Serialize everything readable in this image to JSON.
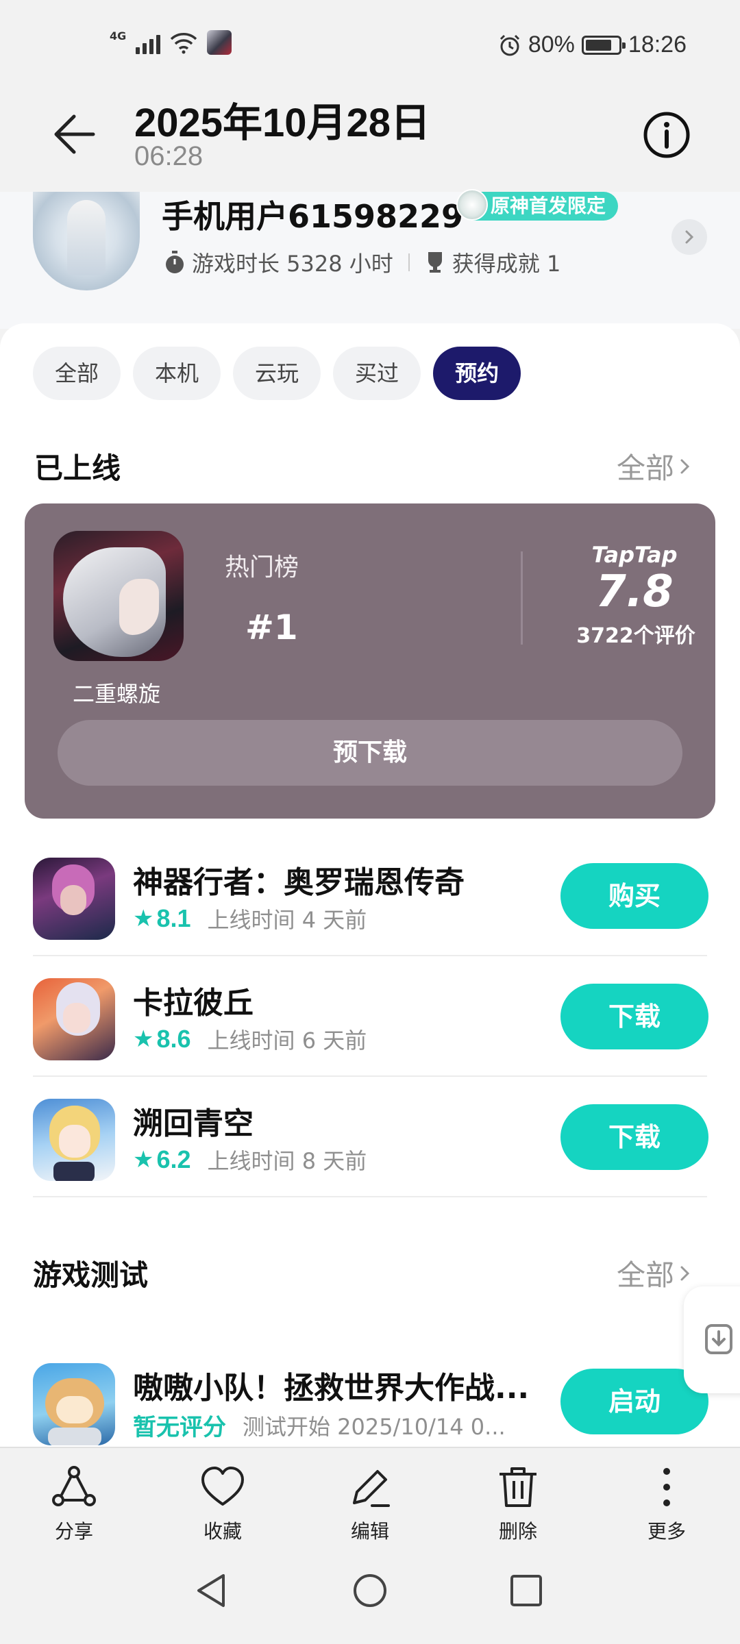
{
  "status": {
    "network": "4G",
    "battery": "80%",
    "time": "18:26"
  },
  "header": {
    "date": "2025年10月28日",
    "time": "06:28"
  },
  "profile": {
    "name": "手机用户61598229",
    "badge": "原神首发限定",
    "playtime": "游戏时长 5328 小时",
    "achievements": "获得成就 1"
  },
  "filters": [
    "全部",
    "本机",
    "云玩",
    "买过",
    "预约"
  ],
  "released_section": {
    "title": "已上线",
    "more": "全部"
  },
  "featured": {
    "name": "二重螺旋",
    "chart_label": "热门榜",
    "rank": "#1",
    "brand": "TapTap",
    "score": "7.8",
    "reviews": "3722个评价",
    "button": "预下载"
  },
  "games": [
    {
      "name": "神器行者：奥罗瑞恩传奇",
      "score": "8.1",
      "info": "上线时间 4 天前",
      "button": "购买"
    },
    {
      "name": "卡拉彼丘",
      "score": "8.6",
      "info": "上线时间 6 天前",
      "button": "下载"
    },
    {
      "name": "溯回青空",
      "score": "6.2",
      "info": "上线时间 8 天前",
      "button": "下载"
    }
  ],
  "test_section": {
    "title": "游戏测试",
    "more": "全部",
    "game": {
      "name": "嗷嗷小队！拯救世界大作战...",
      "score": "暂无评分",
      "info": "测试开始 2025/10/14 0...",
      "button": "启动"
    }
  },
  "toolbar": {
    "share": "分享",
    "favorite": "收藏",
    "edit": "编辑",
    "delete": "删除",
    "more": "更多"
  },
  "colors": {
    "accent": "#15d4c1",
    "active_chip": "#1d1a6b",
    "hero_bg": "#7f6f79"
  }
}
